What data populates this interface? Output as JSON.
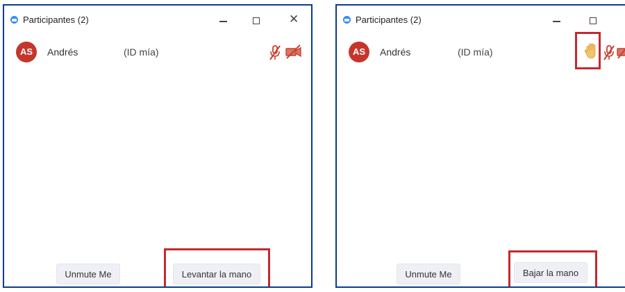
{
  "colors": {
    "accent": "#2d8cff",
    "highlight": "#c22a2f",
    "avatar": "#c6352b",
    "border": "#0b3b8a"
  },
  "left_panel": {
    "title": "Participantes (2)",
    "participant": {
      "initials": "AS",
      "name": "Andrés",
      "role": "(ID mía)"
    },
    "icons": [
      "mic-muted-icon",
      "video-off-icon"
    ],
    "buttons": {
      "unmute": "Unmute Me",
      "hand": "Levantar la mano"
    }
  },
  "right_panel": {
    "title": "Participantes (2)",
    "participant": {
      "initials": "AS",
      "name": "Andrés",
      "role": "(ID mía)"
    },
    "icons": [
      "raised-hand-icon",
      "mic-muted-icon",
      "video-off-icon"
    ],
    "buttons": {
      "unmute": "Unmute Me",
      "hand": "Bajar la mano"
    }
  }
}
